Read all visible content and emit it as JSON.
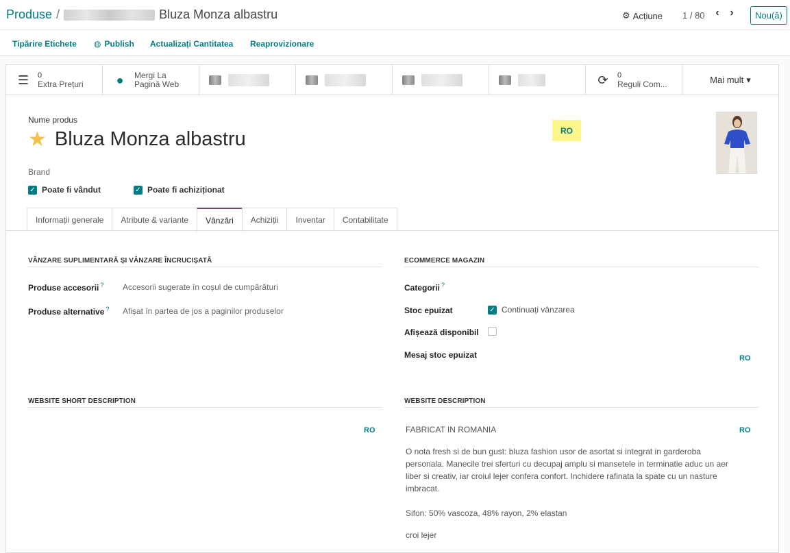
{
  "breadcrumb": {
    "parent": "Produse",
    "separator": "/",
    "current": "Bluza Monza albastru"
  },
  "header": {
    "action_label": "Acțiune",
    "pager": "1 / 80",
    "new_label": "Nou(ă)"
  },
  "actions": {
    "print_labels": "Tipărire Etichete",
    "publish": "Publish",
    "update_qty": "Actualizați Cantitatea",
    "replenish": "Reaprovizionare"
  },
  "stats": {
    "extra_prices": {
      "count": "0",
      "label": "Extra Prețuri"
    },
    "website": {
      "line1": "Mergi La",
      "line2": "Pagină Web"
    },
    "rules": {
      "count": "0",
      "label": "Reguli Com..."
    },
    "more": "Mai mult"
  },
  "product": {
    "name_label": "Nume produs",
    "name": "Bluza Monza albastru",
    "lang": "RO",
    "brand_label": "Brand",
    "can_be_sold": "Poate fi vândut",
    "can_be_purchased": "Poate fi achiziționat"
  },
  "tabs": [
    "Informații generale",
    "Atribute & variante",
    "Vânzări",
    "Achiziții",
    "Inventar",
    "Contabilitate"
  ],
  "sales": {
    "upsell_title": "VÂNZARE SUPLIMENTARĂ ȘI VÂNZARE ÎNCRUCIȘATĂ",
    "accessories_label": "Produse accesorii",
    "accessories_value": "Accesorii sugerate în coșul de cumpărături",
    "alternatives_label": "Produse alternative",
    "alternatives_value": "Afișat în partea de jos a paginilor produselor",
    "ecom_title": "ECOMMERCE MAGAZIN",
    "categories_label": "Categorii",
    "out_of_stock_label": "Stoc epuizat",
    "continue_selling": "Continuați vânzarea",
    "show_available_label": "Afișează disponibil",
    "oos_message_label": "Mesaj stoc epuizat",
    "lang": "RO",
    "short_desc_title": "WEBSITE SHORT DESCRIPTION",
    "desc_title": "WEBSITE DESCRIPTION",
    "desc_p1": "FABRICAT IN ROMANIA",
    "desc_p2": "O nota fresh si de bun gust: bluza fashion usor de asortat si integrat in garderoba personala. Manecile trei sferturi cu decupaj amplu si mansetele in terminatie aduc un aer liber si creativ, iar croiul lejer confera confort. Inchidere rafinata la spate cu un nasture imbracat.",
    "desc_p3": "Sifon: 50% vascoza, 48% rayon, 2% elastan",
    "desc_p4": "croi lejer"
  },
  "colors": {
    "primary": "#017e84",
    "tab_active": "#714b67",
    "star": "#f3c14a",
    "highlight": "#fcf68b"
  }
}
